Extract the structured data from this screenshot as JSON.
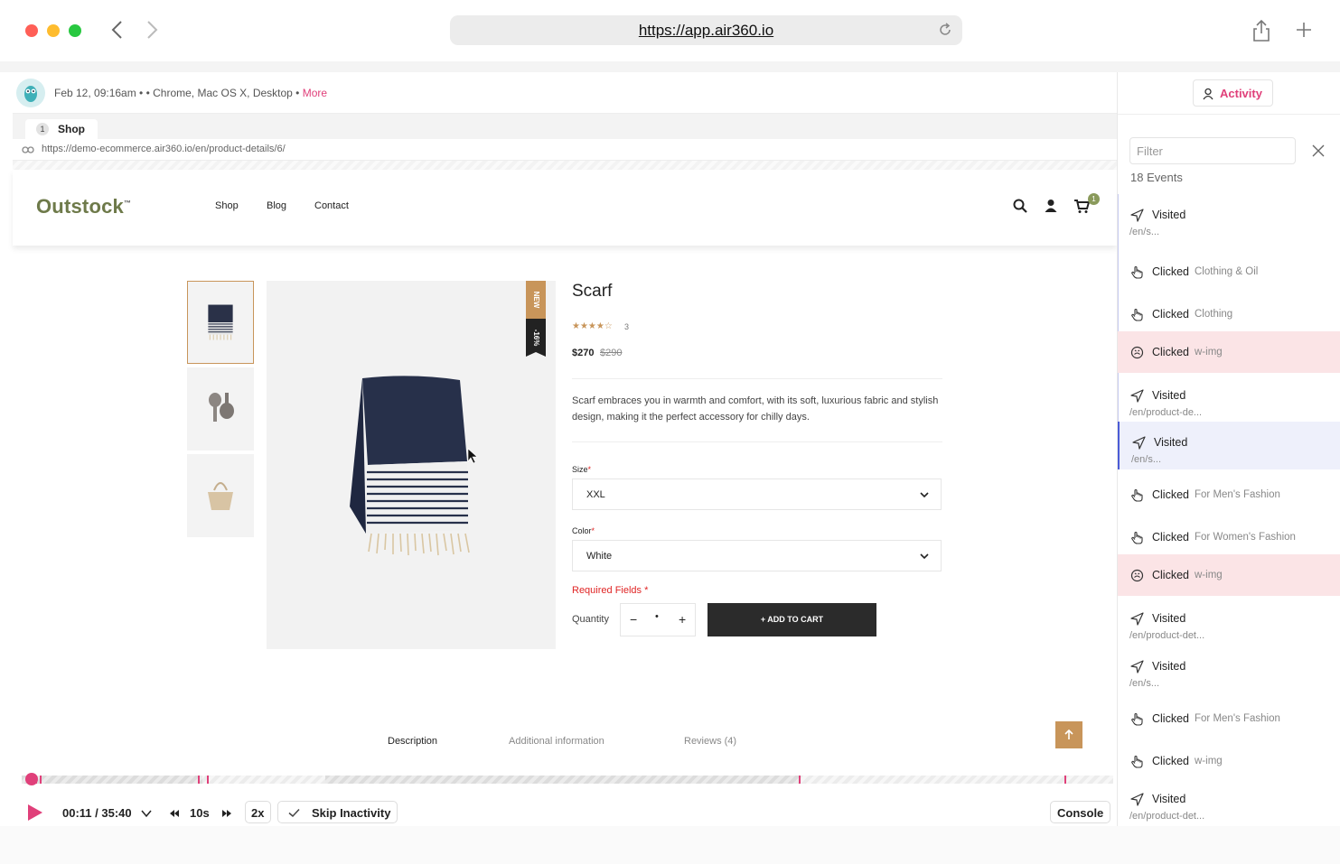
{
  "browser": {
    "url": "https://app.air360.io"
  },
  "session": {
    "info": "Feb 12, 09:16am •  • Chrome, Mac OS X, Desktop •",
    "more_label": "More",
    "tab_number": "1",
    "tab_label": "Shop",
    "page_url": "https://demo-ecommerce.air360.io/en/product-details/6/"
  },
  "shop": {
    "logo": "Outstock",
    "logo_tm": "™",
    "nav": [
      "Shop",
      "Blog",
      "Contact"
    ],
    "cart_count": "1",
    "product": {
      "title": "Scarf",
      "stars": "★★★★☆",
      "rating_count": "3",
      "price": "$270",
      "old_price": "$290",
      "badge_new": "NEW",
      "badge_sale": "-16%",
      "description": "Scarf embraces you in warmth and comfort, with its soft, luxurious fabric and stylish design, making it the perfect accessory for chilly days.",
      "size_label": "Size",
      "size_value": "XXL",
      "color_label": "Color",
      "color_value": "White",
      "required_text": "Required Fields *",
      "quantity_label": "Quantity",
      "quantity_value": "•",
      "add_to_cart": "+ ADD TO CART",
      "required_mark": "*"
    },
    "detail_tabs": [
      "Description",
      "Additional information",
      "Reviews (4)"
    ]
  },
  "player": {
    "time": "00:11 / 35:40",
    "skip_seconds": "10s",
    "speed": "2x",
    "skip_inactivity": "Skip Inactivity",
    "console": "Console",
    "progress_fraction": 0.009
  },
  "sidebar": {
    "activity_label": "Activity",
    "filter_placeholder": "Filter",
    "events_count": "18 Events",
    "events": [
      {
        "type": "visited",
        "action": "Visited",
        "target": "",
        "path": "/en/s..."
      },
      {
        "type": "clicked",
        "action": "Clicked",
        "target": "Clothing & Oil",
        "path": ""
      },
      {
        "type": "clicked",
        "action": "Clicked",
        "target": "Clothing",
        "path": ""
      },
      {
        "type": "rage",
        "action": "Clicked",
        "target": "w-img",
        "path": ""
      },
      {
        "type": "visited",
        "action": "Visited",
        "target": "",
        "path": "/en/product-de..."
      },
      {
        "type": "visited-current",
        "action": "Visited",
        "target": "",
        "path": "/en/s..."
      },
      {
        "type": "clicked",
        "action": "Clicked",
        "target": "For Men's Fashion",
        "path": ""
      },
      {
        "type": "clicked",
        "action": "Clicked",
        "target": "For Women's Fashion",
        "path": ""
      },
      {
        "type": "rage",
        "action": "Clicked",
        "target": "w-img",
        "path": ""
      },
      {
        "type": "visited",
        "action": "Visited",
        "target": "",
        "path": "/en/product-det..."
      },
      {
        "type": "visited",
        "action": "Visited",
        "target": "",
        "path": "/en/s..."
      },
      {
        "type": "clicked",
        "action": "Clicked",
        "target": "For Men's Fashion",
        "path": ""
      },
      {
        "type": "clicked",
        "action": "Clicked",
        "target": "w-img",
        "path": ""
      },
      {
        "type": "visited",
        "action": "Visited",
        "target": "",
        "path": "/en/product-det..."
      }
    ]
  },
  "colors": {
    "accent": "#e0407a",
    "brand_green": "#6e7a4a",
    "product_gold": "#c8955a",
    "rage_bg": "#fbe4e6",
    "current_bg": "#eef0fb"
  }
}
